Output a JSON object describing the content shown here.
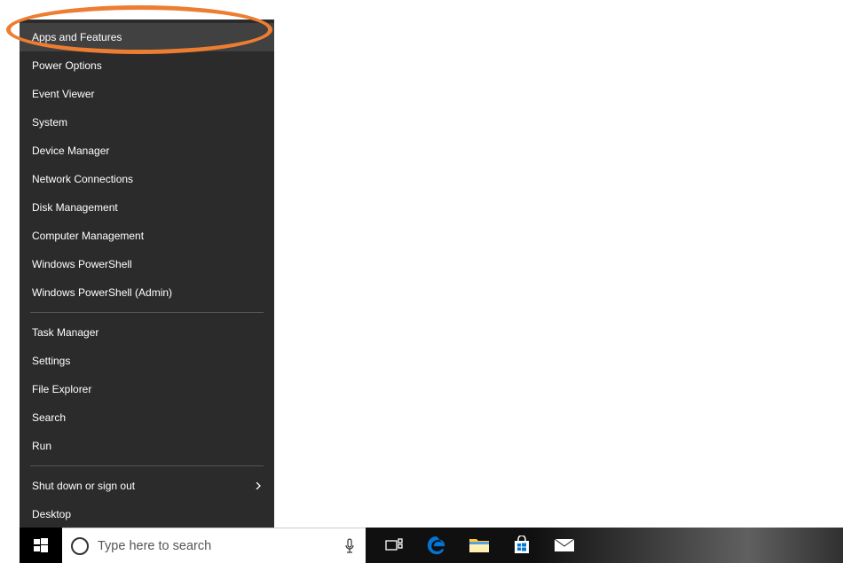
{
  "context_menu": {
    "groups": [
      [
        {
          "label": "Apps and Features",
          "highlighted": true,
          "submenu": false
        },
        {
          "label": "Power Options",
          "highlighted": false,
          "submenu": false
        },
        {
          "label": "Event Viewer",
          "highlighted": false,
          "submenu": false
        },
        {
          "label": "System",
          "highlighted": false,
          "submenu": false
        },
        {
          "label": "Device Manager",
          "highlighted": false,
          "submenu": false
        },
        {
          "label": "Network Connections",
          "highlighted": false,
          "submenu": false
        },
        {
          "label": "Disk Management",
          "highlighted": false,
          "submenu": false
        },
        {
          "label": "Computer Management",
          "highlighted": false,
          "submenu": false
        },
        {
          "label": "Windows PowerShell",
          "highlighted": false,
          "submenu": false
        },
        {
          "label": "Windows PowerShell (Admin)",
          "highlighted": false,
          "submenu": false
        }
      ],
      [
        {
          "label": "Task Manager",
          "highlighted": false,
          "submenu": false
        },
        {
          "label": "Settings",
          "highlighted": false,
          "submenu": false
        },
        {
          "label": "File Explorer",
          "highlighted": false,
          "submenu": false
        },
        {
          "label": "Search",
          "highlighted": false,
          "submenu": false
        },
        {
          "label": "Run",
          "highlighted": false,
          "submenu": false
        }
      ],
      [
        {
          "label": "Shut down or sign out",
          "highlighted": false,
          "submenu": true
        },
        {
          "label": "Desktop",
          "highlighted": false,
          "submenu": false
        }
      ]
    ]
  },
  "taskbar": {
    "search_placeholder": "Type here to search",
    "icons": [
      "task-view-icon",
      "edge-icon",
      "file-explorer-icon",
      "store-icon",
      "mail-icon"
    ]
  }
}
